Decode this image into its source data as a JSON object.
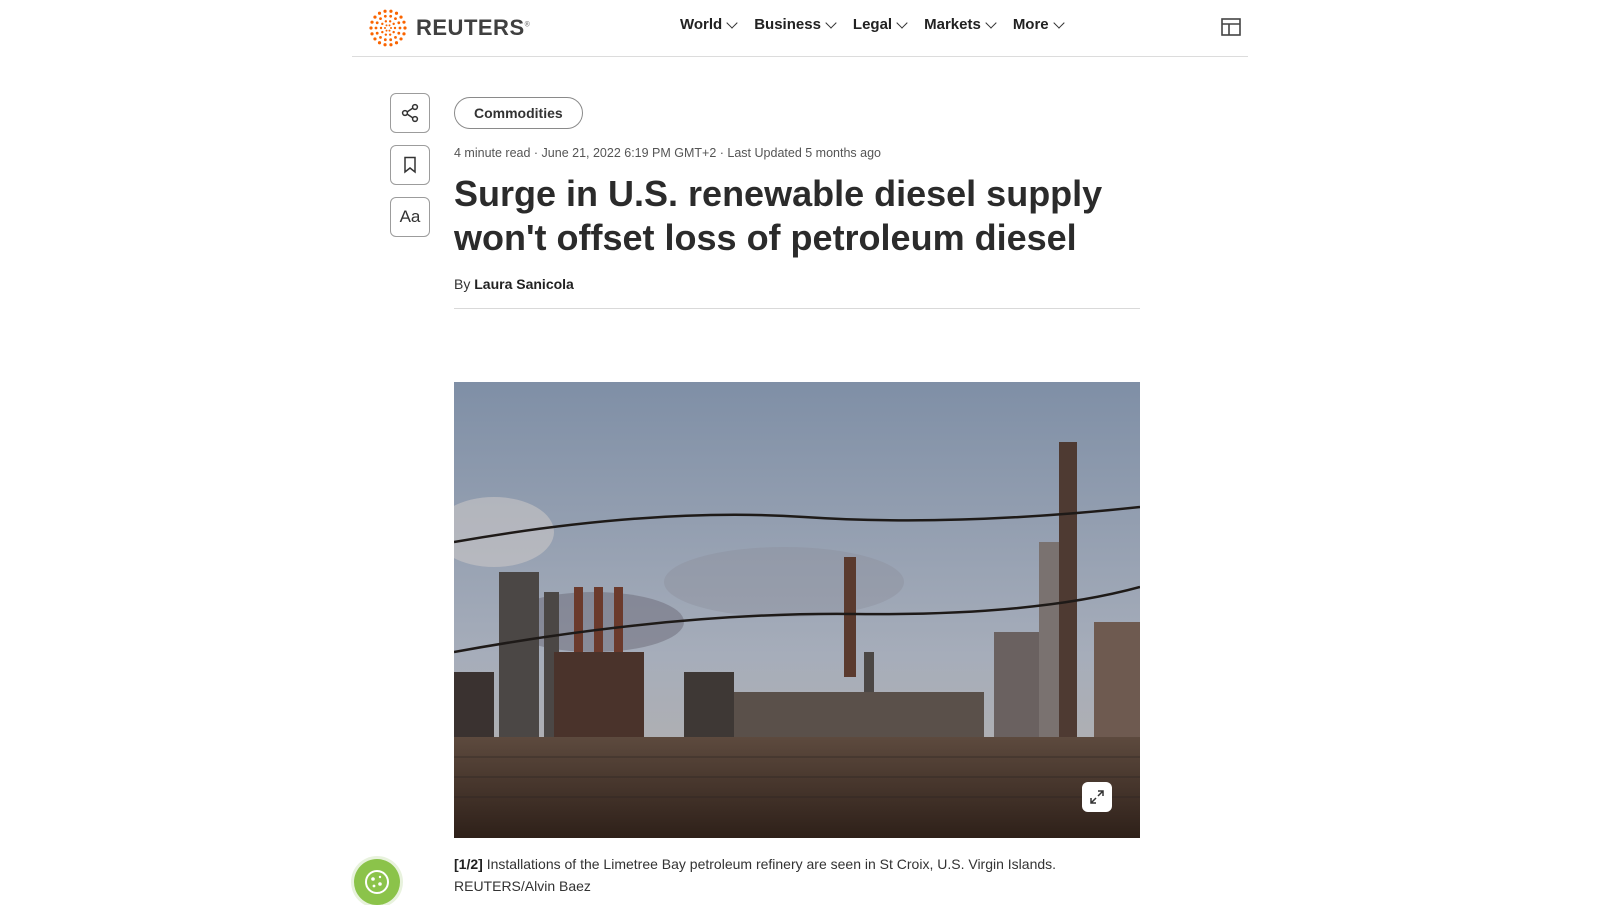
{
  "brand": {
    "name": "REUTERS",
    "mark": "®",
    "accent": "#fa6400"
  },
  "nav": {
    "items": [
      {
        "label": "World"
      },
      {
        "label": "Business"
      },
      {
        "label": "Legal"
      },
      {
        "label": "Markets"
      },
      {
        "label": "More"
      }
    ]
  },
  "tools": {
    "share_icon": "share-icon",
    "bookmark_icon": "bookmark-icon",
    "text_size_label": "Aa"
  },
  "article": {
    "category": "Commodities",
    "meta": "4 minute read · June 21, 2022 6:19 PM GMT+2 · Last Updated 5 months ago",
    "title": "Surge in U.S. renewable diesel supply won't offset loss of petroleum diesel",
    "byline_prefix": "By",
    "author": "Laura Sanicola"
  },
  "image": {
    "counter": "[1/2]",
    "caption": "Installations of the Limetree Bay petroleum refinery are seen in St Croix, U.S. Virgin Islands. REUTERS/Alvin Baez"
  }
}
